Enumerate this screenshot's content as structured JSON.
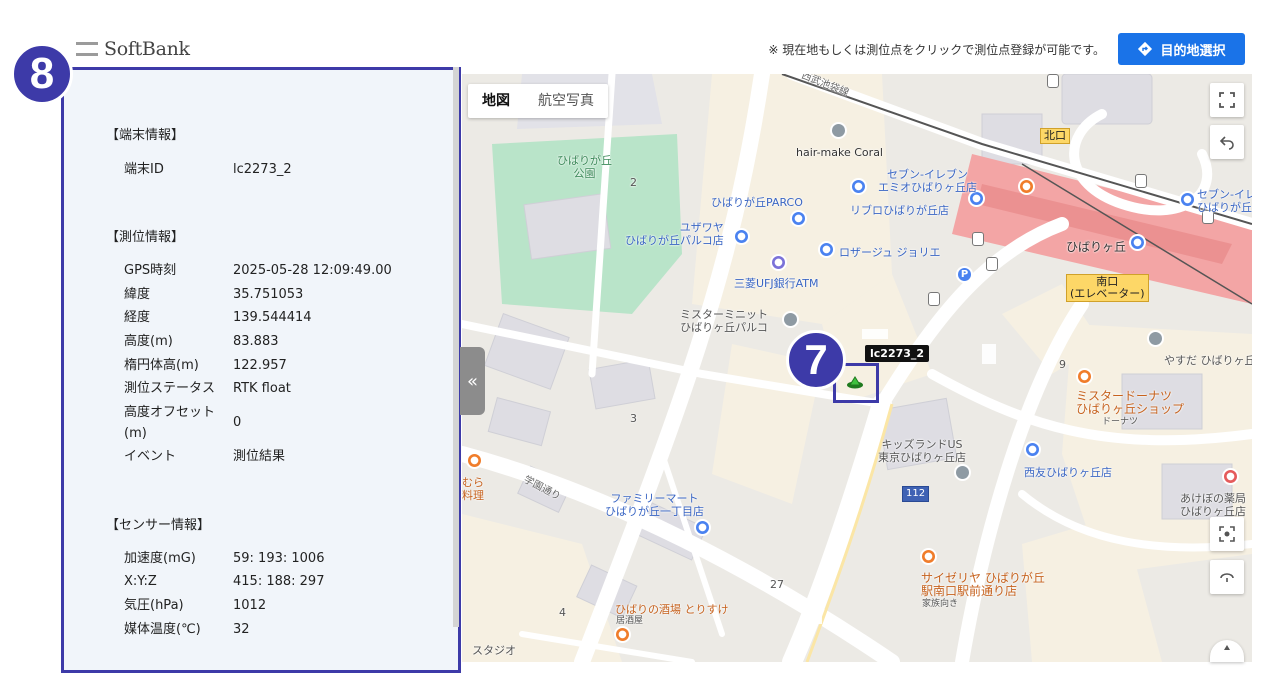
{
  "header": {
    "logo_text": "SoftBank",
    "notice": "※ 現在地もしくは測位点をクリックで測位点登録が可能です。",
    "destination_button": "目的地選択"
  },
  "badges": {
    "panel": "8",
    "device": "7"
  },
  "panel": {
    "terminal_section": "【端末情報】",
    "terminal_rows": [
      {
        "label": "端末ID",
        "value": "lc2273_2"
      }
    ],
    "positioning_section": "【測位情報】",
    "positioning_rows": [
      {
        "label": "GPS時刻",
        "value": "2025-05-28 12:09:49.00"
      },
      {
        "label": "緯度",
        "value": "35.751053"
      },
      {
        "label": "経度",
        "value": "139.544414"
      },
      {
        "label": "高度(m)",
        "value": "83.883"
      },
      {
        "label": "楕円体高(m)",
        "value": "122.957"
      },
      {
        "label": "測位ステータス",
        "value": "RTK float"
      },
      {
        "label": "高度オフセット(m)",
        "value": "0"
      },
      {
        "label": "イベント",
        "value": "測位結果"
      }
    ],
    "sensor_section": "【センサー情報】",
    "sensor_rows": [
      {
        "label": "加速度(mG)",
        "value": "59: 193: 1006"
      },
      {
        "label": "X:Y:Z",
        "value": "415: 188: 297"
      },
      {
        "label": "気圧(hPa)",
        "value": "1012"
      },
      {
        "label": "媒体温度(℃)",
        "value": "32"
      }
    ],
    "collapse_glyph": "«"
  },
  "map": {
    "tabs": [
      {
        "label": "地図",
        "active": true
      },
      {
        "label": "航空写真",
        "active": false
      }
    ],
    "device_label": "lc2273_2",
    "labels": {
      "railway": "西武池袋線",
      "park": "ひばりが丘\n公園",
      "hair": "hair-make Coral",
      "seven1": "セブン-イレブン\nエミオひばりヶ丘店",
      "parco": "ひばりが丘PARCO",
      "libro": "リブロひばりが丘店",
      "yuzawaya": "ユザワヤ\nひばりが丘パルコ店",
      "rosage": "ロザージュ ジョリエ",
      "mufg": "三菱UFJ銀行ATM",
      "misdo_minit": "ミスターミニット\nひばりヶ丘パルコ",
      "station": "ひばりヶ丘",
      "seven2": "セブン-イレ\nひばりが丘",
      "yasuda": "やすだ ひばりヶ丘",
      "misdo": "ミスタードーナツ\nひばりヶ丘ショップ",
      "misdo_sub": "ドーナツ",
      "kidsland": "キッズランドUS\n東京ひばりヶ丘店",
      "seiyu": "西友ひばりヶ丘店",
      "akebono": "あけぼの薬局\nひばりヶ丘店",
      "family": "ファミリーマート\nひばりが丘一丁目店",
      "saizeriya": "サイゼリヤ ひばりが丘\n駅南口駅前通り店",
      "saizeriya_sub": "家族向き",
      "izakaya": "ひばりの酒場 とりすけ",
      "izakaya_sub": "居酒屋",
      "gakuen": "学園通り",
      "mura": "むら\n料理",
      "studio": "スタジオ",
      "north_exit": "北口",
      "south_exit": "南口\n(エレベーター)",
      "route": "112",
      "parking": "P",
      "n2": "2",
      "n3": "3",
      "n4": "4",
      "n9": "9",
      "n27": "27"
    }
  },
  "colors": {
    "accent": "#1a73e8",
    "badge": "#3d3aa8",
    "station": "#f3a5a5",
    "park": "#b9e4c9"
  }
}
